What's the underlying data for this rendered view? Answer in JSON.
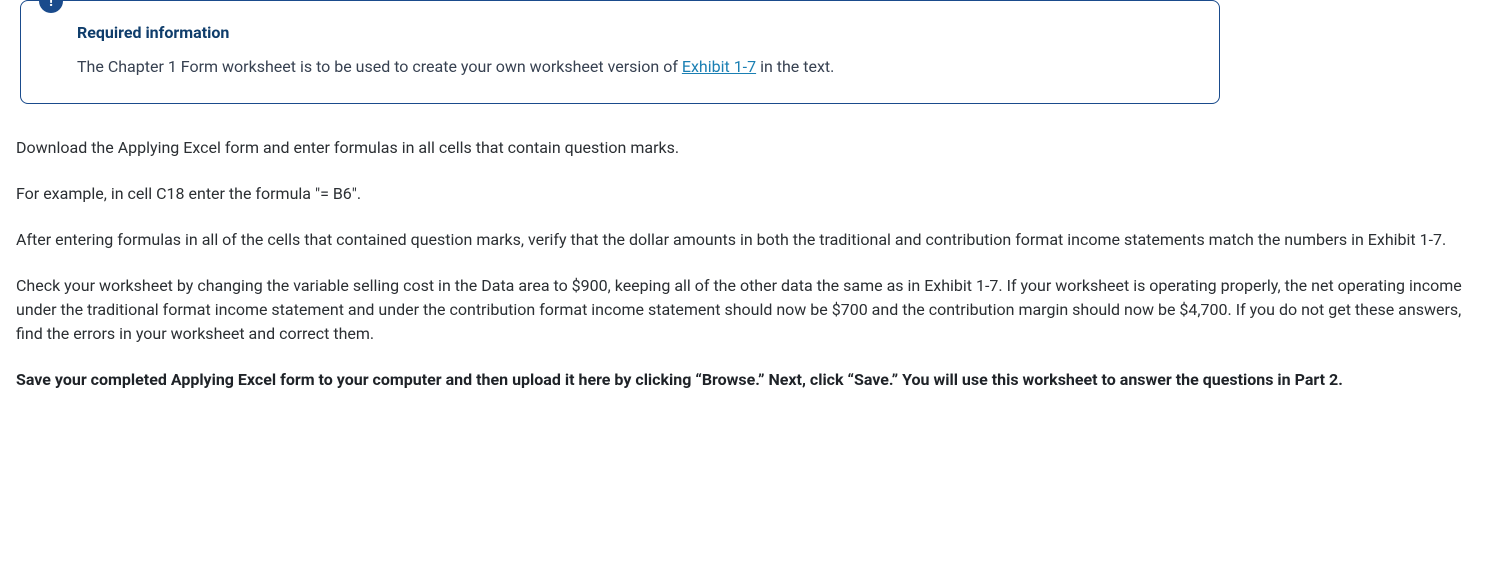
{
  "info": {
    "icon_glyph": "!",
    "title": "Required information",
    "body_pre": "The Chapter 1 Form worksheet is to be used to create your own worksheet version of ",
    "link_text": "Exhibit 1-7",
    "body_post": " in the text."
  },
  "paragraphs": {
    "p1": "Download the Applying Excel form and enter formulas in all cells that contain question marks.",
    "p2": "For example, in cell C18 enter the formula \"= B6\".",
    "p3": "After entering formulas in all of the cells that contained question marks, verify that the dollar amounts in both the traditional and contribution format income statements match the numbers in Exhibit 1-7.",
    "p4": "Check your worksheet by changing the variable selling cost in the Data area to $900, keeping all of the other data the same as in Exhibit 1-7. If your worksheet is operating properly, the net operating income under the traditional format income statement and under the contribution format income statement should now be $700 and the contribution margin should now be $4,700. If you do not get these answers, find the errors in your worksheet and correct them.",
    "p5": "Save your completed Applying Excel form to your computer and then upload it here by clicking “Browse.” Next, click “Save.” You will use this worksheet to answer the questions in Part 2."
  }
}
